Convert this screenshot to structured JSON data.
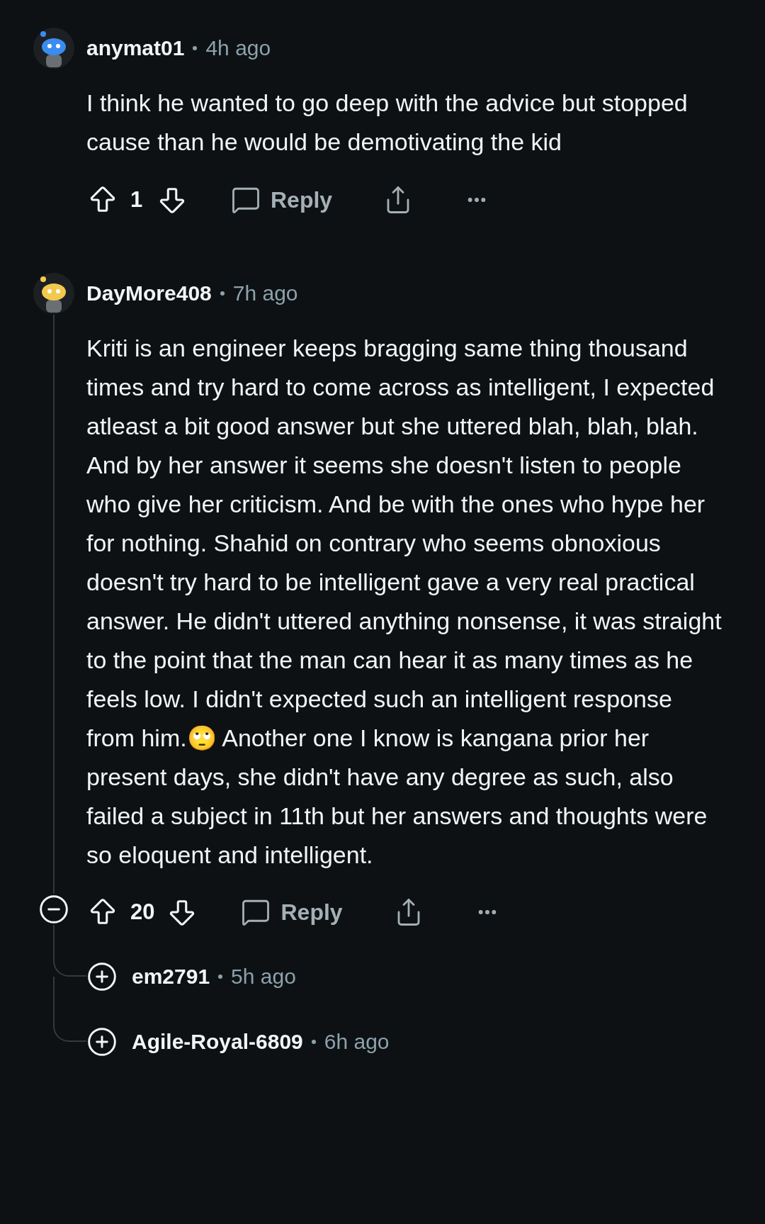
{
  "comments": [
    {
      "author": "anymat01",
      "time": "4h ago",
      "avatar": {
        "color": "#3b8cf0"
      },
      "body": "I think he wanted to go deep with the advice but stopped cause than he would be demotivating the kid",
      "votes": "1",
      "reply_label": "Reply"
    },
    {
      "author": "DayMore408",
      "time": "7h ago",
      "avatar": {
        "color": "#f2c94c"
      },
      "expanded": true,
      "body": "Kriti is an engineer keeps bragging same thing thousand times and try hard to come across as intelligent, I expected atleast a bit good answer but she uttered blah, blah, blah. And by her answer it seems she doesn't listen to people who give her criticism. And be with the ones who hype her for nothing. Shahid on contrary who seems obnoxious doesn't try hard to be intelligent gave a very real practical answer. He didn't uttered anything nonsense, it was straight to the point that the man can hear it as many times as he feels low. I didn't expected such an intelligent response from him.🙄 Another one I know is kangana prior her present days, she didn't have any degree as such, also failed a subject in 11th but her answers and thoughts were so eloquent and intelligent.",
      "votes": "20",
      "reply_label": "Reply",
      "replies": [
        {
          "author": "em2791",
          "time": "5h ago",
          "expanded": false
        },
        {
          "author": "Agile-Royal-6809",
          "time": "6h ago",
          "expanded": false
        }
      ]
    }
  ]
}
